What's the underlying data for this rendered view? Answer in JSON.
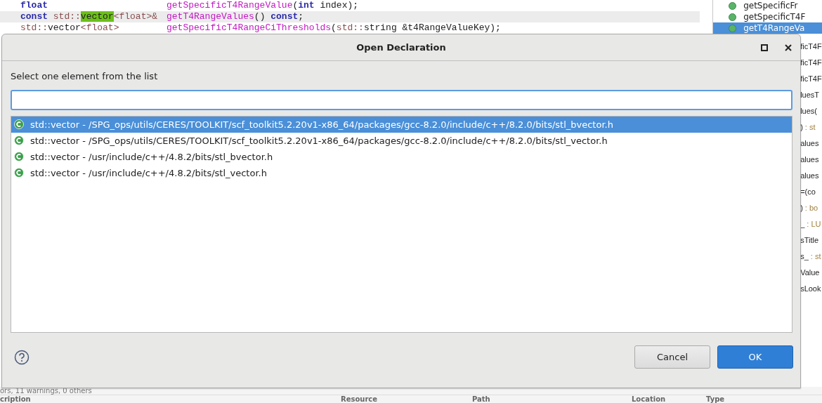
{
  "editor": {
    "lines": [
      {
        "highlighted": false,
        "decl": [
          {
            "text": "float",
            "kind": "keyword"
          }
        ],
        "body": [
          {
            "text": "getSpecificT4RangeValue",
            "kind": "func"
          },
          {
            "text": "(",
            "kind": "plain"
          },
          {
            "text": "int",
            "kind": "keyword"
          },
          {
            "text": " index);",
            "kind": "plain"
          }
        ]
      },
      {
        "highlighted": true,
        "decl": [
          {
            "text": "const",
            "kind": "keyword"
          },
          {
            "text": " std::",
            "kind": "type"
          },
          {
            "text": "vector",
            "kind": "match"
          },
          {
            "text": "<float>&",
            "kind": "type"
          }
        ],
        "body": [
          {
            "text": "getT4RangeValues",
            "kind": "func"
          },
          {
            "text": "() ",
            "kind": "plain"
          },
          {
            "text": "const",
            "kind": "keyword"
          },
          {
            "text": ";",
            "kind": "plain"
          }
        ]
      },
      {
        "highlighted": false,
        "decl": [
          {
            "text": "std::",
            "kind": "type"
          },
          {
            "text": "vector",
            "kind": "plain"
          },
          {
            "text": "<float>",
            "kind": "type"
          }
        ],
        "body": [
          {
            "text": "getSpecificT4RangeCiThresholds",
            "kind": "func"
          },
          {
            "text": "(",
            "kind": "plain"
          },
          {
            "text": "std::",
            "kind": "type"
          },
          {
            "text": "string &t4RangeValueKey);",
            "kind": "plain"
          }
        ]
      }
    ]
  },
  "outline": {
    "items": [
      {
        "name": "getSpecificFr",
        "kind": "full",
        "selected": false
      },
      {
        "name": "getSpecificT4F",
        "kind": "full",
        "selected": false
      },
      {
        "name": "getT4RangeVa",
        "kind": "full",
        "selected": true
      },
      {
        "name": "ficT4F",
        "kind": "clipped",
        "selected": false
      },
      {
        "name": "ficT4F",
        "kind": "clipped",
        "selected": false
      },
      {
        "name": "ficT4F",
        "kind": "clipped",
        "selected": false
      },
      {
        "name": "luesT",
        "kind": "clipped",
        "selected": false
      },
      {
        "name": "lues(",
        "kind": "clipped",
        "selected": false
      },
      {
        "name": ")",
        "type": ": st",
        "kind": "clipped",
        "selected": false
      },
      {
        "name": "alues",
        "kind": "clipped",
        "selected": false
      },
      {
        "name": "alues",
        "kind": "clipped",
        "selected": false
      },
      {
        "name": "alues",
        "kind": "clipped",
        "selected": false
      },
      {
        "name": "=(co",
        "kind": "clipped",
        "selected": false
      },
      {
        "name": ")",
        "type": ": bo",
        "kind": "clipped",
        "selected": false
      },
      {
        "name": "_",
        "type": ": LU",
        "kind": "clipped",
        "selected": false
      },
      {
        "name": "sTitle",
        "kind": "clipped",
        "selected": false
      },
      {
        "name": "s_",
        "type": ": st",
        "kind": "clipped",
        "selected": false
      },
      {
        "name": "Value",
        "kind": "clipped",
        "selected": false
      },
      {
        "name": "sLook",
        "kind": "clipped",
        "selected": false
      }
    ]
  },
  "problems": {
    "summary": "ors, 11 warnings, 0 others",
    "columns": [
      "cription",
      "Resource",
      "Path",
      "Location",
      "Type"
    ]
  },
  "dialog": {
    "title": "Open Declaration",
    "prompt": "Select one element from the list",
    "filter": {
      "focused": true
    },
    "items": [
      {
        "label": "std::vector - /SPG_ops/utils/CERES/TOOLKIT/scf_toolkit5.2.20v1-x86_64/packages/gcc-8.2.0/include/c++/8.2.0/bits/stl_bvector.h",
        "selected": true
      },
      {
        "label": "std::vector - /SPG_ops/utils/CERES/TOOLKIT/scf_toolkit5.2.20v1-x86_64/packages/gcc-8.2.0/include/c++/8.2.0/bits/stl_vector.h",
        "selected": false
      },
      {
        "label": "std::vector - /usr/include/c++/4.8.2/bits/stl_bvector.h",
        "selected": false
      },
      {
        "label": "std::vector - /usr/include/c++/4.8.2/bits/stl_vector.h",
        "selected": false
      }
    ],
    "buttons": [
      {
        "label": "Cancel",
        "kind": "secondary"
      },
      {
        "label": "OK",
        "kind": "primary"
      }
    ]
  }
}
